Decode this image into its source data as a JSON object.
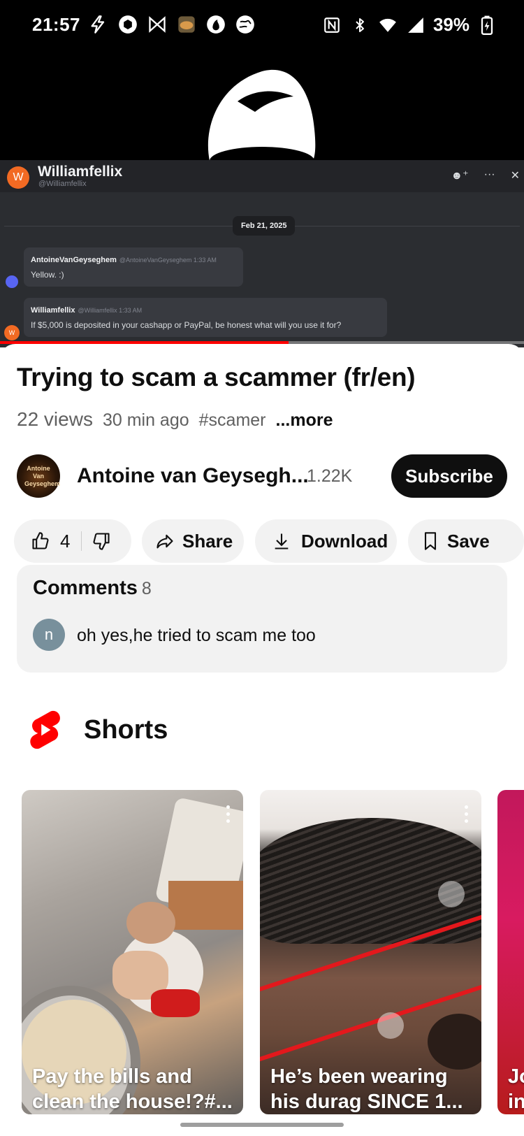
{
  "status_bar": {
    "time": "21:57",
    "battery": "39%",
    "left_icons": [
      "bolt-icon",
      "hexagon-app-icon",
      "bowtie-app-icon",
      "bread-app-icon",
      "pokeball-app-icon",
      "globe-app-icon"
    ],
    "right_icons": [
      "nfc-icon",
      "bluetooth-icon",
      "wifi-icon",
      "signal-icon",
      "battery-charging-icon"
    ]
  },
  "video": {
    "chat": {
      "avatar_letter": "W",
      "name": "Williamfellix",
      "handle": "@Williamfellix",
      "date": "Feb 21, 2025",
      "messages": [
        {
          "author": "AntoineVanGeyseghem",
          "meta": "@AntoineVanGeyseghem  1:33 AM",
          "text": "Yellow. :)"
        },
        {
          "author": "Williamfellix",
          "meta": "@Williamfellix  1:33 AM",
          "text": "If $5,000 is deposited in your cashapp or PayPal, be honest what will you use it for?"
        }
      ]
    },
    "progress_fraction": 0.55,
    "progress_color": "#ff0000"
  },
  "info": {
    "title": "Trying to scam a scammer (fr/en)",
    "views": "22 views",
    "ago": "30 min ago",
    "hashtag": "#scamer",
    "more": "...more"
  },
  "channel": {
    "avatar_text": "Antoine Van Geyseghem",
    "name": "Antoine van Geysegh...",
    "subscribers": "1.22K",
    "subscribe_label": "Subscribe"
  },
  "actions": {
    "likes": "4",
    "share": "Share",
    "download": "Download",
    "save": "Save"
  },
  "comments": {
    "title": "Comments",
    "count": "8",
    "top_avatar": "n",
    "top_comment": "oh yes,he tried to scam me too"
  },
  "shorts": {
    "label": "Shorts",
    "items": [
      {
        "line1": "Pay the bills and",
        "line2": "clean the house!?#..."
      },
      {
        "line1": "He’s been wearing",
        "line2": "his durag SINCE 1..."
      },
      {
        "line1": "Jo",
        "line2": "in"
      }
    ]
  },
  "colors": {
    "brand_red": "#ff0000",
    "subscribe_bg": "#0f0f0f",
    "pill_bg": "#f2f2f2"
  }
}
